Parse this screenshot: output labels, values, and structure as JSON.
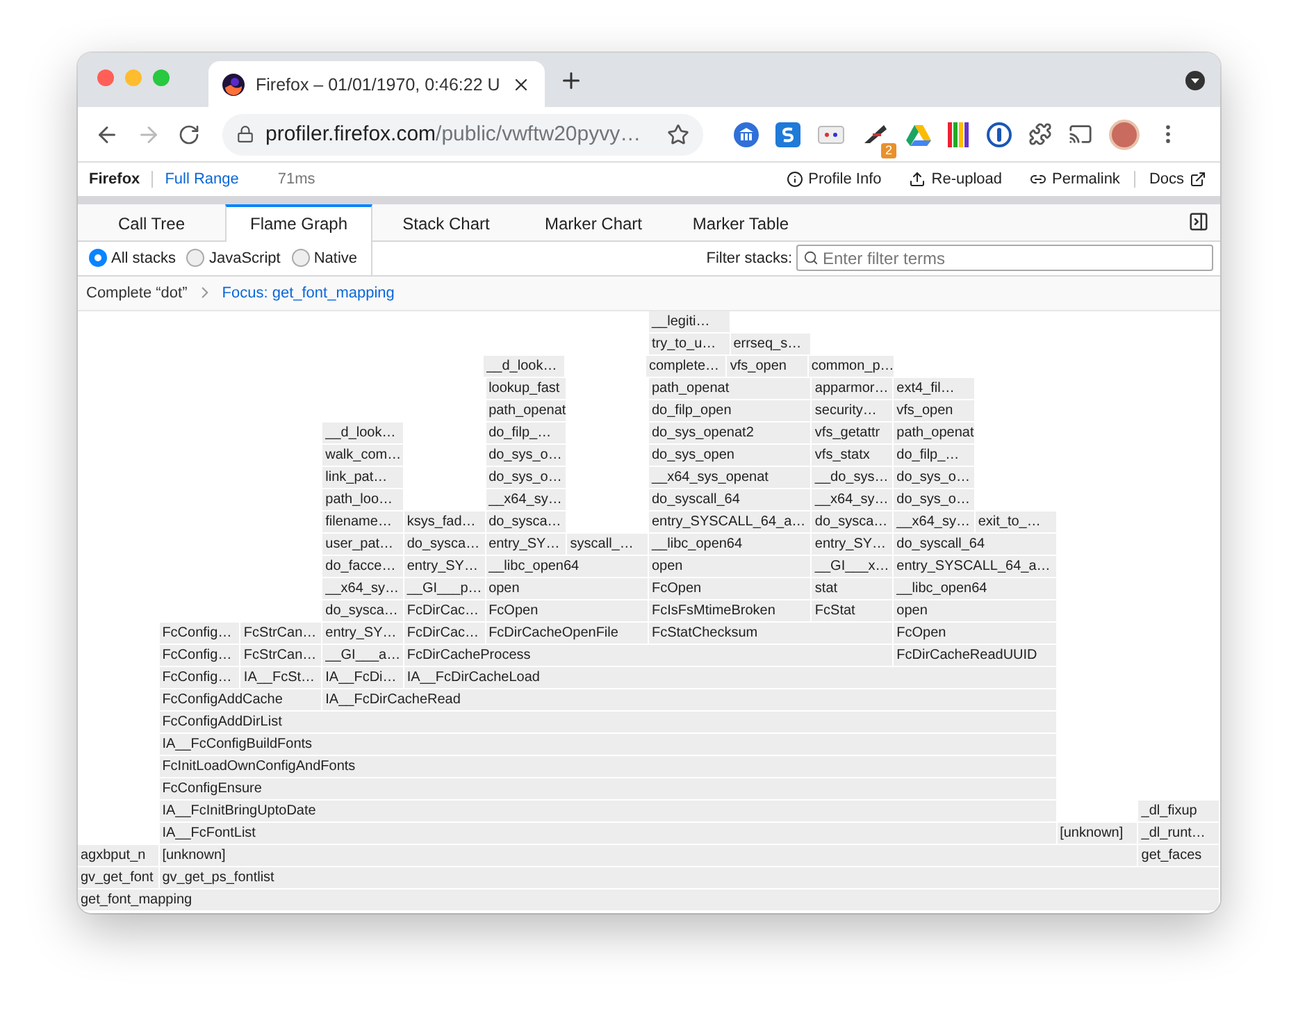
{
  "browser": {
    "tab_title": "Firefox – 01/01/1970, 0:46:22 U",
    "url_host": "profiler.firefox.com",
    "url_path": "/public/vwftw20pyvy…",
    "extension_badge": "2"
  },
  "profiler_bar": {
    "product": "Firefox",
    "range": "Full Range",
    "duration": "71ms",
    "actions": [
      {
        "kind": "info",
        "label": "Profile Info"
      },
      {
        "kind": "upload",
        "label": "Re-upload"
      },
      {
        "kind": "link",
        "label": "Permalink"
      },
      {
        "kind": "docs",
        "label": "Docs"
      }
    ]
  },
  "tabs": [
    {
      "label": "Call Tree",
      "selected": false
    },
    {
      "label": "Flame Graph",
      "selected": true
    },
    {
      "label": "Stack Chart",
      "selected": false
    },
    {
      "label": "Marker Chart",
      "selected": false
    },
    {
      "label": "Marker Table",
      "selected": false
    }
  ],
  "stack_filter": {
    "options": [
      {
        "label": "All stacks",
        "selected": true
      },
      {
        "label": "JavaScript",
        "selected": false
      },
      {
        "label": "Native",
        "selected": false
      }
    ],
    "filter_label": "Filter stacks:",
    "placeholder": "Enter filter terms"
  },
  "breadcrumbs": [
    {
      "label": "Complete “dot”",
      "selected": false
    },
    {
      "label": "Focus: get_font_mapping",
      "selected": true
    }
  ],
  "flame_graph": {
    "rows": [
      [
        "__legiti…"
      ],
      [
        "try_to_u…",
        "errseq_s…"
      ],
      [
        "__d_look…",
        "complete…",
        "vfs_open",
        "common_p…"
      ],
      [
        "lookup_fast",
        "path_openat",
        "apparmor…",
        "ext4_fil…"
      ],
      [
        "path_openat",
        "do_filp_open",
        "security…",
        "vfs_open"
      ],
      [
        "__d_look…",
        "do_filp_…",
        "do_sys_openat2",
        "vfs_getattr",
        "path_openat"
      ],
      [
        "walk_com…",
        "do_sys_o…",
        "do_sys_open",
        "vfs_statx",
        "do_filp_…"
      ],
      [
        "link_pat…",
        "do_sys_o…",
        "__x64_sys_openat",
        "__do_sys…",
        "do_sys_o…"
      ],
      [
        "path_loo…",
        "__x64_sy…",
        "do_syscall_64",
        "__x64_sy…",
        "do_sys_o…"
      ],
      [
        "filename…",
        "ksys_fad…",
        "do_sysca…",
        "entry_SYSCALL_64_a…",
        "do_sysca…",
        "__x64_sy…",
        "exit_to_…"
      ],
      [
        "user_pat…",
        "do_sysca…",
        "entry_SY…",
        "syscall_…",
        "__libc_open64",
        "entry_SY…",
        "do_syscall_64"
      ],
      [
        "do_facce…",
        "entry_SY…",
        "__libc_open64",
        "open",
        "__GI___x…",
        "entry_SYSCALL_64_a…"
      ],
      [
        "__x64_sy…",
        "__GI___p…",
        "open",
        "FcOpen",
        "stat",
        "__libc_open64"
      ],
      [
        "do_sysca…",
        "FcDirCac…",
        "FcOpen",
        "FcIsFsMtimeBroken",
        "FcStat",
        "open"
      ],
      [
        "FcConfig…",
        "FcStrCan…",
        "entry_SY…",
        "FcDirCac…",
        "FcDirCacheOpenFile",
        "FcStatChecksum",
        "FcOpen"
      ],
      [
        "FcConfig…",
        "FcStrCan…",
        "__GI___a…",
        "FcDirCacheProcess",
        "FcDirCacheReadUUID"
      ],
      [
        "FcConfig…",
        "IA__FcSt…",
        "IA__FcDi…",
        "IA__FcDirCacheLoad"
      ],
      [
        "FcConfigAddCache",
        "IA__FcDirCacheRead"
      ],
      [
        "FcConfigAddDirList"
      ],
      [
        "IA__FcConfigBuildFonts"
      ],
      [
        "FcInitLoadOwnConfigAndFonts"
      ],
      [
        "FcConfigEnsure"
      ],
      [
        "IA__FcInitBringUptoDate",
        "_dl_fixup"
      ],
      [
        "IA__FcFontList",
        "[unknown]",
        "_dl_runt…"
      ],
      [
        "agxbput_n",
        "[unknown]",
        "get_faces"
      ],
      [
        "gv_get_font",
        "gv_get_ps_fontlist"
      ],
      [
        "get_font_mapping"
      ]
    ]
  }
}
